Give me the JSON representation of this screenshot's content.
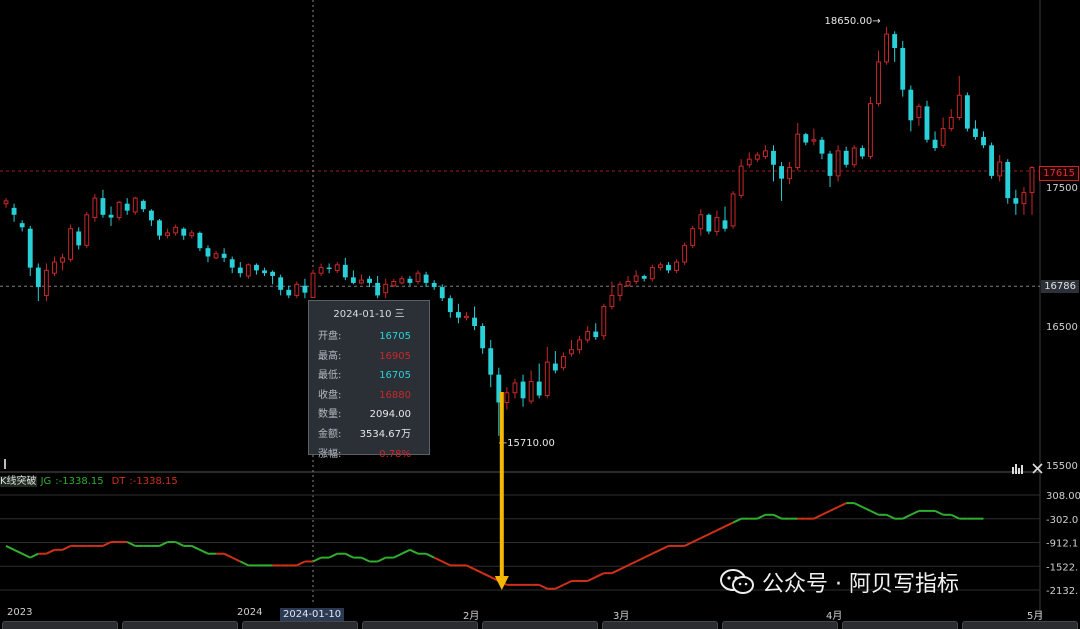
{
  "chart_data": {
    "type": "candlestick",
    "price_axis": {
      "ticks": [
        "17500",
        "16500",
        "15500"
      ],
      "tick_values": [
        17500,
        16500,
        15500
      ],
      "ref_lines": [
        {
          "value": 17615,
          "label": "17615",
          "color": "#c8282a"
        },
        {
          "value": 16786,
          "label": "16786",
          "color": "#9aa0a6"
        }
      ]
    },
    "x_labels": [
      "2023",
      "2024",
      "2月",
      "3月",
      "4月",
      "5月"
    ],
    "crosshair_date": "2024-01-10",
    "annotations": {
      "high": "18650.00→",
      "low": "←15710.00"
    },
    "candles": [
      [
        17380,
        17400,
        17350,
        17420
      ],
      [
        17350,
        17300,
        17250,
        17380
      ],
      [
        17240,
        17210,
        17180,
        17260
      ],
      [
        17200,
        16920,
        16860,
        17220
      ],
      [
        16920,
        16780,
        16680,
        16950
      ],
      [
        16720,
        16900,
        16680,
        16950
      ],
      [
        16880,
        16960,
        16860,
        17000
      ],
      [
        16960,
        16990,
        16900,
        17020
      ],
      [
        16980,
        17200,
        16960,
        17230
      ],
      [
        17180,
        17080,
        17050,
        17210
      ],
      [
        17080,
        17300,
        17060,
        17320
      ],
      [
        17280,
        17420,
        17250,
        17450
      ],
      [
        17420,
        17300,
        17280,
        17480
      ],
      [
        17300,
        17280,
        17220,
        17360
      ],
      [
        17280,
        17390,
        17260,
        17400
      ],
      [
        17380,
        17330,
        17300,
        17420
      ],
      [
        17320,
        17420,
        17300,
        17430
      ],
      [
        17400,
        17340,
        17320,
        17410
      ],
      [
        17330,
        17260,
        17220,
        17340
      ],
      [
        17260,
        17150,
        17120,
        17270
      ],
      [
        17150,
        17170,
        17130,
        17200
      ],
      [
        17170,
        17210,
        17150,
        17230
      ],
      [
        17200,
        17150,
        17120,
        17210
      ],
      [
        17150,
        17170,
        17130,
        17190
      ],
      [
        17170,
        17060,
        17040,
        17180
      ],
      [
        17060,
        17000,
        16960,
        17080
      ],
      [
        16990,
        17020,
        16980,
        17040
      ],
      [
        17020,
        16990,
        16960,
        17060
      ],
      [
        16980,
        16920,
        16880,
        17000
      ],
      [
        16920,
        16880,
        16850,
        16960
      ],
      [
        16860,
        16940,
        16840,
        16950
      ],
      [
        16940,
        16900,
        16870,
        16950
      ],
      [
        16900,
        16880,
        16860,
        16920
      ],
      [
        16890,
        16860,
        16800,
        16900
      ],
      [
        16850,
        16760,
        16720,
        16870
      ],
      [
        16760,
        16720,
        16700,
        16790
      ],
      [
        16720,
        16800,
        16700,
        16820
      ],
      [
        16790,
        16740,
        16700,
        16840
      ],
      [
        16705,
        16880,
        16705,
        16905
      ],
      [
        16880,
        16920,
        16860,
        16950
      ],
      [
        16920,
        16910,
        16880,
        16950
      ],
      [
        16900,
        16940,
        16880,
        16960
      ],
      [
        16940,
        16850,
        16830,
        16990
      ],
      [
        16850,
        16810,
        16800,
        16900
      ],
      [
        16810,
        16830,
        16800,
        16870
      ],
      [
        16840,
        16810,
        16780,
        16860
      ],
      [
        16810,
        16720,
        16700,
        16860
      ],
      [
        16740,
        16800,
        16700,
        16840
      ],
      [
        16790,
        16820,
        16780,
        16840
      ],
      [
        16810,
        16840,
        16800,
        16860
      ],
      [
        16840,
        16810,
        16790,
        16860
      ],
      [
        16820,
        16880,
        16800,
        16900
      ],
      [
        16870,
        16810,
        16780,
        16890
      ],
      [
        16810,
        16780,
        16760,
        16830
      ],
      [
        16780,
        16700,
        16680,
        16800
      ],
      [
        16700,
        16600,
        16560,
        16720
      ],
      [
        16600,
        16560,
        16520,
        16660
      ],
      [
        16560,
        16570,
        16540,
        16600
      ],
      [
        16560,
        16500,
        16470,
        16640
      ],
      [
        16500,
        16340,
        16300,
        16520
      ],
      [
        16340,
        16150,
        16060,
        16400
      ],
      [
        16150,
        15950,
        15710,
        16200
      ],
      [
        15950,
        16020,
        15900,
        16060
      ],
      [
        16020,
        16090,
        15980,
        16120
      ],
      [
        16100,
        15980,
        15920,
        16150
      ],
      [
        15960,
        16100,
        15940,
        16180
      ],
      [
        16100,
        16000,
        15980,
        16230
      ],
      [
        16000,
        16240,
        15980,
        16350
      ],
      [
        16230,
        16180,
        16160,
        16320
      ],
      [
        16200,
        16280,
        16180,
        16310
      ],
      [
        16300,
        16330,
        16280,
        16400
      ],
      [
        16330,
        16400,
        16300,
        16430
      ],
      [
        16400,
        16460,
        16380,
        16500
      ],
      [
        16460,
        16420,
        16400,
        16520
      ],
      [
        16430,
        16640,
        16400,
        16660
      ],
      [
        16640,
        16720,
        16620,
        16820
      ],
      [
        16720,
        16800,
        16680,
        16820
      ],
      [
        16790,
        16820,
        16780,
        16860
      ],
      [
        16820,
        16860,
        16800,
        16900
      ],
      [
        16860,
        16840,
        16820,
        16870
      ],
      [
        16840,
        16920,
        16820,
        16940
      ],
      [
        16920,
        16940,
        16900,
        16960
      ],
      [
        16940,
        16900,
        16880,
        16960
      ],
      [
        16900,
        16960,
        16880,
        16980
      ],
      [
        16960,
        17080,
        16940,
        17100
      ],
      [
        17080,
        17200,
        17060,
        17220
      ],
      [
        17200,
        17300,
        17150,
        17340
      ],
      [
        17300,
        17180,
        17160,
        17310
      ],
      [
        17180,
        17280,
        17150,
        17330
      ],
      [
        17260,
        17200,
        17180,
        17360
      ],
      [
        17220,
        17450,
        17200,
        17470
      ],
      [
        17440,
        17650,
        17420,
        17700
      ],
      [
        17660,
        17700,
        17640,
        17750
      ],
      [
        17700,
        17730,
        17680,
        17750
      ],
      [
        17720,
        17760,
        17700,
        17800
      ],
      [
        17760,
        17660,
        17540,
        17800
      ],
      [
        17650,
        17560,
        17400,
        17680
      ],
      [
        17560,
        17640,
        17520,
        17680
      ],
      [
        17640,
        17880,
        17620,
        17960
      ],
      [
        17880,
        17820,
        17800,
        17890
      ],
      [
        17830,
        17840,
        17800,
        17920
      ],
      [
        17840,
        17740,
        17700,
        17860
      ],
      [
        17740,
        17580,
        17500,
        17760
      ],
      [
        17580,
        17760,
        17540,
        17800
      ],
      [
        17760,
        17660,
        17640,
        17790
      ],
      [
        17660,
        17780,
        17640,
        17800
      ],
      [
        17780,
        17720,
        17700,
        17800
      ],
      [
        17720,
        18100,
        17700,
        18150
      ],
      [
        18100,
        18400,
        18080,
        18480
      ],
      [
        18400,
        18600,
        18380,
        18650
      ],
      [
        18600,
        18500,
        18400,
        18620
      ],
      [
        18500,
        18200,
        18150,
        18550
      ],
      [
        18200,
        17980,
        17900,
        18230
      ],
      [
        18000,
        18080,
        17940,
        18100
      ],
      [
        18080,
        17840,
        17820,
        18120
      ],
      [
        17840,
        17780,
        17760,
        17900
      ],
      [
        17800,
        17920,
        17780,
        18000
      ],
      [
        17920,
        18000,
        17900,
        18060
      ],
      [
        18000,
        18160,
        17980,
        18300
      ],
      [
        18160,
        17920,
        17900,
        18180
      ],
      [
        17920,
        17860,
        17840,
        17980
      ],
      [
        17860,
        17800,
        17780,
        17900
      ],
      [
        17800,
        17580,
        17560,
        17820
      ],
      [
        17580,
        17680,
        17540,
        17730
      ],
      [
        17680,
        17420,
        17380,
        17700
      ],
      [
        17420,
        17380,
        17300,
        17480
      ],
      [
        17380,
        17460,
        17300,
        17500
      ],
      [
        17460,
        17640,
        17300,
        17650
      ]
    ],
    "indicator": {
      "name": "K线突破",
      "series": [
        {
          "name": "JG",
          "value": "-1338.15",
          "color": "#2fae2f"
        },
        {
          "name": "DT",
          "value": "-1338.15",
          "color": "#d03018"
        }
      ],
      "ticks": [
        "308.00",
        "-302.0",
        "-912.1",
        "-1522.",
        "-2132."
      ],
      "tick_values": [
        308,
        -302,
        -912.1,
        -1522,
        -2132
      ],
      "values": [
        -1000,
        -1100,
        -1200,
        -1300,
        -1200,
        -1200,
        -1100,
        -1100,
        -1000,
        -1000,
        -1000,
        -1000,
        -1000,
        -900,
        -900,
        -900,
        -1000,
        -1000,
        -1000,
        -1000,
        -900,
        -900,
        -1000,
        -1000,
        -1100,
        -1200,
        -1200,
        -1200,
        -1300,
        -1400,
        -1500,
        -1500,
        -1500,
        -1500,
        -1500,
        -1500,
        -1500,
        -1400,
        -1400,
        -1300,
        -1300,
        -1200,
        -1200,
        -1300,
        -1300,
        -1400,
        -1400,
        -1300,
        -1300,
        -1200,
        -1100,
        -1200,
        -1200,
        -1300,
        -1400,
        -1500,
        -1500,
        -1500,
        -1600,
        -1700,
        -1800,
        -1900,
        -2000,
        -2000,
        -2000,
        -2000,
        -2000,
        -2100,
        -2100,
        -2000,
        -1900,
        -1900,
        -1900,
        -1800,
        -1700,
        -1700,
        -1600,
        -1500,
        -1400,
        -1300,
        -1200,
        -1100,
        -1000,
        -1000,
        -1000,
        -900,
        -800,
        -700,
        -600,
        -500,
        -400,
        -300,
        -300,
        -300,
        -200,
        -200,
        -300,
        -300,
        -300,
        -300,
        -300,
        -200,
        -100,
        0,
        100,
        100,
        0,
        -100,
        -200,
        -200,
        -300,
        -300,
        -200,
        -100,
        -100,
        -100,
        -200,
        -200,
        -300,
        -300,
        -300,
        -300
      ],
      "colors": "ggggrrrrrrrrrrrgggggggggggrrrggggrrrrrgggggggggggggggrrrrrrrrrrrrrrrrrrrrrrrrrrrrrrrrrrrrrggggggggrrrrrrgggggggggggggggggggggg"
    }
  },
  "tooltip": {
    "date": "2024-01-10  三",
    "rows": [
      {
        "label": "开盘:",
        "value": "16705"
      },
      {
        "label": "最高:",
        "value": "16905"
      },
      {
        "label": "最低:",
        "value": "16705"
      },
      {
        "label": "收盘:",
        "value": "16880"
      },
      {
        "label": "数量:",
        "value": "2094.00"
      },
      {
        "label": "金额:",
        "value": "3534.67万"
      },
      {
        "label": "涨幅:",
        "value": "0.78%"
      }
    ]
  },
  "watermark": "公众号 · 阿贝写指标",
  "colors": {
    "up": "#c8282a",
    "down": "#2ad0d8",
    "arrow": "#f5b800"
  }
}
